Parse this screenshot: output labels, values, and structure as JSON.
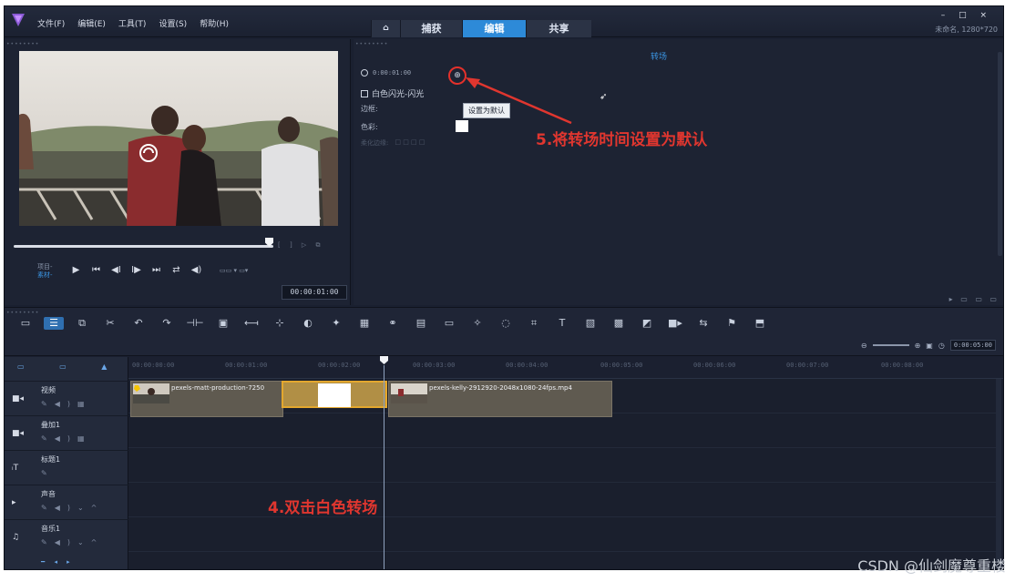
{
  "menu": {
    "items": [
      "文件(F)",
      "编辑(E)",
      "工具(T)",
      "设置(S)",
      "帮助(H)"
    ]
  },
  "tabs": [
    {
      "label": "⌂"
    },
    {
      "label": "捕获"
    },
    {
      "label": "编辑"
    },
    {
      "label": "共享"
    }
  ],
  "window": {
    "controls": "– □ ×",
    "project_info": "未命名, 1280*720"
  },
  "player": {
    "mode_project": "项目-",
    "mode_clip": "素材-",
    "timecode": "00:00:01:00"
  },
  "options": {
    "title": "转场",
    "duration": "0:00:01:00",
    "default_button_icon": "⊕",
    "effect_name": "白色闪光-闪光",
    "border_label": "边框:",
    "color_label": "色彩:",
    "softedge_label": "柔化边缘:",
    "tooltip": "设置为默认",
    "annotation": "5.将转场时间设置为默认"
  },
  "toolbar": {
    "zoom_time": "0:00:05:00"
  },
  "ruler": {
    "ticks": [
      "00:00:00:00",
      "00:00:01:00",
      "00:00:02:00",
      "00:00:03:00",
      "00:00:04:00",
      "00:00:05:00",
      "00:00:06:00",
      "00:00:07:00",
      "00:00:08:00"
    ]
  },
  "tracks": [
    {
      "name": "视频",
      "icon": "video-icon"
    },
    {
      "name": "叠加1",
      "icon": "overlay-icon"
    },
    {
      "name": "标题1",
      "icon": "title-icon"
    },
    {
      "name": "声音",
      "icon": "voice-icon"
    },
    {
      "name": "音乐1",
      "icon": "music-icon"
    }
  ],
  "clips": {
    "clip1": "pexels-matt-production-7250",
    "clip2": "pexels-kelly-2912920-2048x1080-24fps.mp4"
  },
  "annotation4": "4.双击白色转场",
  "watermark": "CSDN @仙剑魔尊重楼",
  "colors": {
    "accent": "#2d8ad8",
    "annotation_red": "#e0362f",
    "transition_border": "#e3a72e"
  }
}
